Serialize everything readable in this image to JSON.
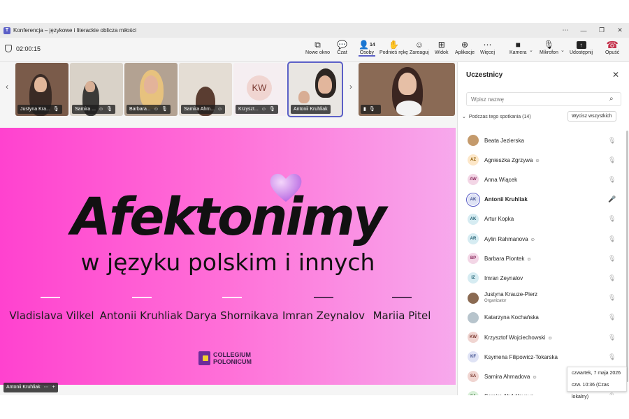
{
  "window": {
    "title": "Konferencja – językowe i literackie oblicza miłości",
    "app_icon": "teams-icon"
  },
  "toolbar": {
    "timer": "02:00:15",
    "buttons": [
      {
        "label": "Nowe okno",
        "icon": "new-window-icon"
      },
      {
        "label": "Czat",
        "icon": "chat-icon"
      },
      {
        "label": "Osoby",
        "icon": "people-icon",
        "count": "14"
      },
      {
        "label": "Podnieś rękę",
        "icon": "raise-hand-icon"
      },
      {
        "label": "Zareaguj",
        "icon": "react-icon"
      },
      {
        "label": "Widok",
        "icon": "view-icon"
      },
      {
        "label": "Aplikacje",
        "icon": "apps-icon"
      },
      {
        "label": "Więcej",
        "icon": "more-icon"
      },
      {
        "label": "Kamera",
        "icon": "camera-icon"
      },
      {
        "label": "Mikrofon",
        "icon": "mic-icon"
      },
      {
        "label": "Udostępnij",
        "icon": "share-icon"
      },
      {
        "label": "Opuść",
        "icon": "hangup-icon"
      }
    ]
  },
  "strip": {
    "tiles": [
      {
        "label": "Justyna Kra..."
      },
      {
        "label": "Samira ..."
      },
      {
        "label": "Barbara..."
      },
      {
        "label": "Samira Ahm..."
      },
      {
        "label": "Krzyszt...",
        "initials": "KW"
      },
      {
        "label": "Antonii Kruhliak"
      },
      {
        "label": ""
      }
    ]
  },
  "slide": {
    "title": "Afektonimy",
    "subtitle": "w języku polskim i innych",
    "authors": [
      "Vladislava Vilkel",
      "Antonii Kruhliak",
      "Darya Shornikava",
      "Imran Zeynalov",
      "Mariia Pitel"
    ],
    "logo_line1": "COLLEGIUM",
    "logo_line2": "POLONICUM"
  },
  "presenter_label": "Antonii Kruhliak",
  "participants": {
    "title": "Uczestnicy",
    "search_placeholder": "Wpisz nazwę",
    "section": "Podczas tego spotkania (14)",
    "mute_all": "Wycisz wszystkich",
    "list": [
      {
        "name": "Beata Jezierska",
        "initials": "",
        "bg": "#c49a6c",
        "fg": "#ffffff"
      },
      {
        "name": "Agnieszka Zgrzywa",
        "initials": "AZ",
        "bg": "#fde7c8",
        "fg": "#8a5a00",
        "reaction": "true"
      },
      {
        "name": "Anna Wiącek",
        "initials": "AW",
        "bg": "#f3d6e6",
        "fg": "#8a2b5d"
      },
      {
        "name": "Antonii Kruhliak",
        "initials": "AK",
        "bg": "#dfe3f5",
        "fg": "#3b4a8a",
        "selected": "true",
        "speaking": "true"
      },
      {
        "name": "Artur Kopka",
        "initials": "AK",
        "bg": "#d6ecf2",
        "fg": "#1d5c6e"
      },
      {
        "name": "Aylin Rahmanova",
        "initials": "AR",
        "bg": "#d6ecf2",
        "fg": "#1d5c6e",
        "reaction": "true"
      },
      {
        "name": "Barbara Piontek",
        "initials": "BP",
        "bg": "#f3d6e6",
        "fg": "#8a2b5d",
        "reaction": "true"
      },
      {
        "name": "Imran Zeynalov",
        "initials": "IZ",
        "bg": "#d6ecf2",
        "fg": "#1d5c6e"
      },
      {
        "name": "Justyna Krauze-Pierz",
        "initials": "",
        "bg": "#8a6a52",
        "fg": "#ffffff",
        "sub": "Organizator"
      },
      {
        "name": "Katarzyna Kochańska",
        "initials": "",
        "bg": "#b7c4cc",
        "fg": "#ffffff"
      },
      {
        "name": "Krzysztof Wojciechowski",
        "initials": "KW",
        "bg": "#f0d5d1",
        "fg": "#7b3b33",
        "reaction": "true"
      },
      {
        "name": "Ksymena Filipowicz-Tokarska",
        "initials": "KF",
        "bg": "#dfe3f5",
        "fg": "#3b4a8a"
      },
      {
        "name": "Samira Ahmadova",
        "initials": "SA",
        "bg": "#f0d5d1",
        "fg": "#7b3b33",
        "reaction": "true"
      },
      {
        "name": "Samira Abdullayeva",
        "initials": "SA",
        "bg": "#d8efd8",
        "fg": "#2d6a2d",
        "reaction": "true"
      }
    ]
  },
  "tooltip": {
    "date": "czwartek, 7 maja 2026",
    "time": "czw. 10:36 (Czas lokalny)"
  },
  "colors": {
    "accent": "#5b5fc7",
    "slide_pink": "#ff42cf",
    "hangup": "#c4314b"
  }
}
